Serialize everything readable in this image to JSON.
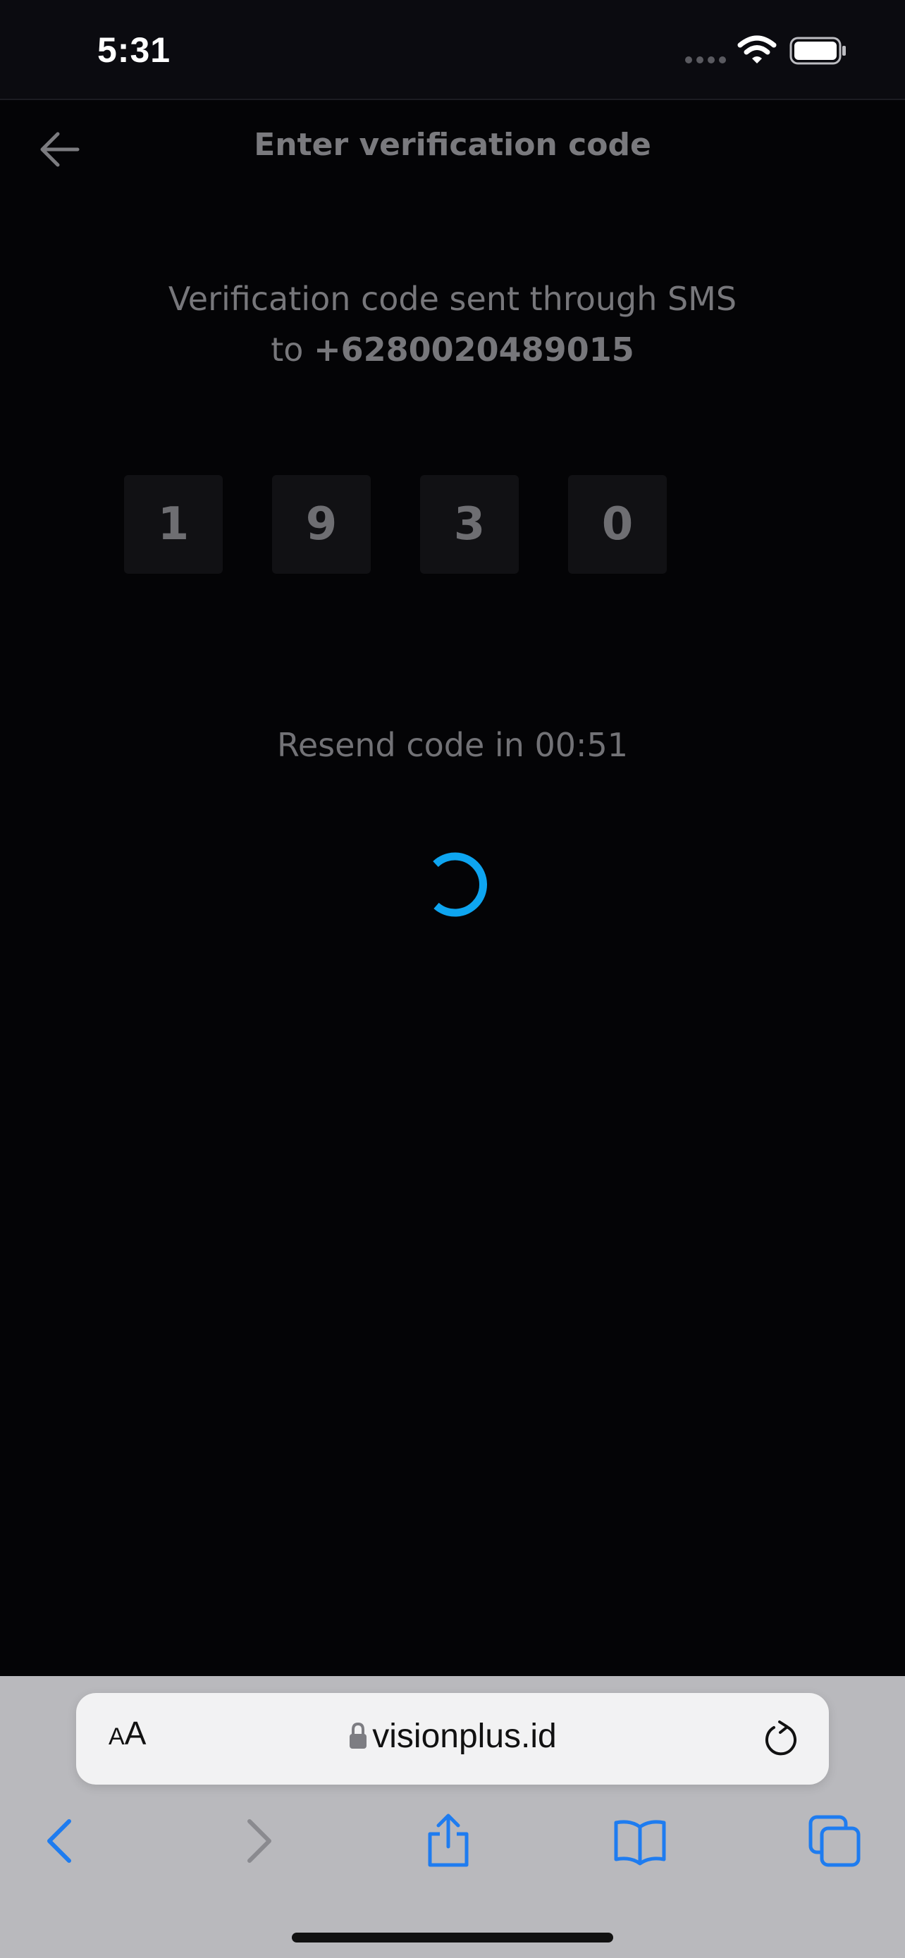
{
  "status_bar": {
    "time": "5:31",
    "icons": [
      "cellular-signal-icon",
      "wifi-icon",
      "battery-icon"
    ]
  },
  "header": {
    "back_icon": "arrow-left-icon",
    "title": "Enter verification code"
  },
  "info": {
    "line1": "Verification code sent through SMS",
    "line2_prefix": "to ",
    "phone": "+6280020489015"
  },
  "otp": {
    "digits": [
      "1",
      "9",
      "3",
      "0"
    ]
  },
  "resend": {
    "text": "Resend code in 00:51"
  },
  "spinner": {
    "color": "#0ea5f0",
    "state": "loading"
  },
  "browser": {
    "aa_small": "A",
    "aa_large": "A",
    "url": "visionplus.id",
    "toolbar_icons": [
      "back-icon",
      "forward-icon",
      "share-icon",
      "bookmarks-icon",
      "tabs-icon"
    ],
    "accent": "#1e7cf0"
  },
  "colors": {
    "background": "#040406",
    "status_bar": "#0b0b10",
    "browser_bar": "#b9b9bd"
  }
}
